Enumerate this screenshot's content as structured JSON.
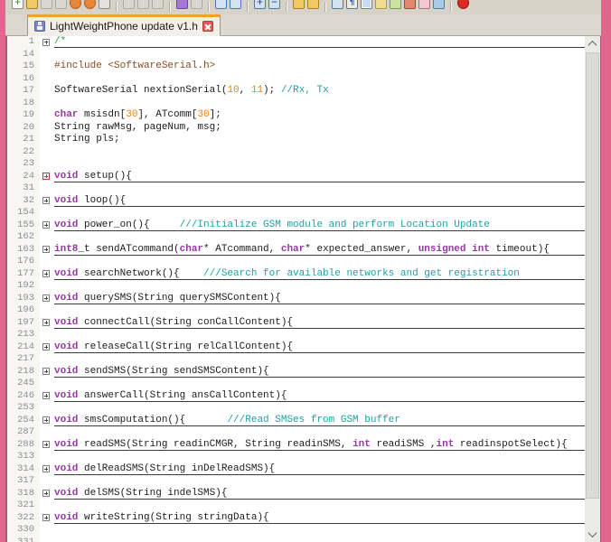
{
  "tab": {
    "title": "LightWeightPhone update v1.h"
  },
  "colors": {
    "window_border": "#E0668D",
    "window_border_inner": "#A85878",
    "toolbar_bg": "#D7D3C8",
    "tabbar_bg": "#DCD8CF",
    "tab_active_bg": "#F2EFE9",
    "tab_active_top": "#EFA22E",
    "tab_border": "#9A968E",
    "tab_close_bg": "#DF5A56",
    "floppy_icon": "#7F86C4",
    "editor_bg": "#FFFFFF",
    "gutter_bg": "#F7F6F3",
    "line_number": "#8D8D96",
    "fold_line": "#3A3A3A",
    "fold_box_border": "#7E7E7E",
    "fold_box_red": "#C23432",
    "keyword": "#9638A4",
    "number": "#EF8300",
    "comment": "#1BA2A6",
    "preprocessor": "#8A4A22",
    "block_comment": "#2E9E3E",
    "code_text": "#1C1C1C",
    "scroll_track": "#ECECE7",
    "scroll_thumb": "#DCDCD6",
    "scroll_arrow": "#5A5A5A"
  },
  "toolbar": {
    "groups": [
      [
        {
          "name": "new-file-button",
          "bg": "#FFFFFF",
          "border": "#8A8A82",
          "glyph": "+",
          "fg": "#3AA53A"
        },
        {
          "name": "open-file-button",
          "bg": "#F0C965",
          "border": "#AA8025"
        },
        {
          "name": "save-button",
          "bg": "#D9D7D0",
          "border": "#ABABA3",
          "state": "disabled"
        },
        {
          "name": "save-all-button",
          "bg": "#D9D7D0",
          "border": "#ABABA3",
          "state": "disabled"
        },
        {
          "name": "close-button",
          "bg": "#E8863C",
          "border": "#B55A14",
          "shape": "round"
        },
        {
          "name": "close-all-button",
          "bg": "#E8863C",
          "border": "#B55A14",
          "shape": "round"
        },
        {
          "name": "print-button",
          "bg": "#E3E2DC",
          "border": "#8A8A82"
        }
      ],
      [
        {
          "name": "cut-button",
          "bg": "#D9D7D0",
          "border": "#ABABA3",
          "state": "disabled"
        },
        {
          "name": "copy-button",
          "bg": "#D9D7D0",
          "border": "#ABABA3",
          "state": "disabled"
        },
        {
          "name": "paste-button",
          "bg": "#D9D7D0",
          "border": "#ABABA3",
          "state": "disabled"
        }
      ],
      [
        {
          "name": "undo-button",
          "bg": "#A477D8",
          "border": "#6E3FAE"
        },
        {
          "name": "redo-button",
          "bg": "#D9D7D0",
          "border": "#ABABA3",
          "state": "disabled"
        }
      ],
      [
        {
          "name": "find-button",
          "bg": "#D5E2F2",
          "border": "#4A7AB6"
        },
        {
          "name": "replace-button",
          "bg": "#D5E2F2",
          "border": "#4A7AB6"
        }
      ],
      [
        {
          "name": "zoom-in-button",
          "bg": "#D5E2F2",
          "border": "#4A7AB6",
          "glyph": "+",
          "fg": "#2B5FA8"
        },
        {
          "name": "zoom-out-button",
          "bg": "#D5E2F2",
          "border": "#4A7AB6",
          "glyph": "−",
          "fg": "#2B5FA8"
        }
      ],
      [
        {
          "name": "sync-vertical-scrolling-button",
          "bg": "#F0C965",
          "border": "#AA8025"
        },
        {
          "name": "sync-horizontal-scrolling-button",
          "bg": "#F0C965",
          "border": "#AA8025"
        }
      ],
      [
        {
          "name": "word-wrap-button",
          "bg": "#D5E2F2",
          "border": "#4A7AB6"
        },
        {
          "name": "show-all-characters-button",
          "bg": "#EDEDE8",
          "border": "#4A7AB6",
          "glyph": "¶",
          "fg": "#2B5FA8"
        },
        {
          "name": "show-indent-guide-button",
          "bg": "#C9DCF2",
          "border": "#4E82C8",
          "state": "pressed"
        },
        {
          "name": "user-defined-language-button",
          "bg": "#EFDE8E",
          "border": "#A89A3E"
        },
        {
          "name": "document-map-button",
          "bg": "#CBE3A2",
          "border": "#6FA23E"
        },
        {
          "name": "function-list-button",
          "bg": "#E2876F",
          "border": "#A8442A"
        },
        {
          "name": "folder-as-workspace-button",
          "bg": "#F2C7D4",
          "border": "#BE6484"
        },
        {
          "name": "monitoring-button",
          "bg": "#A9C9E9",
          "border": "#4A7AB6"
        }
      ],
      [
        {
          "name": "start-recording-macro-button",
          "bg": "#DA2C20",
          "border": "#8E150E",
          "shape": "round"
        }
      ]
    ]
  },
  "editor": {
    "rows": [
      {
        "n": 1,
        "fold": "plus",
        "folded": true,
        "segs": [
          [
            "grn",
            "/*"
          ]
        ]
      },
      {
        "n": 14,
        "segs": []
      },
      {
        "n": 15,
        "segs": [
          [
            "pre",
            "#include <SoftwareSerial.h>"
          ]
        ]
      },
      {
        "n": 16,
        "segs": []
      },
      {
        "n": 17,
        "segs": [
          [
            "pl",
            "SoftwareSerial nextionSerial("
          ],
          [
            "num",
            "10"
          ],
          [
            "pl",
            ", "
          ],
          [
            "num",
            "11"
          ],
          [
            "pl",
            "); "
          ],
          [
            "cmt",
            "//Rx, Tx"
          ]
        ]
      },
      {
        "n": 18,
        "segs": []
      },
      {
        "n": 19,
        "segs": [
          [
            "kw",
            "char"
          ],
          [
            "pl",
            " msisdn["
          ],
          [
            "num",
            "30"
          ],
          [
            "pl",
            "], ATcomm["
          ],
          [
            "num",
            "30"
          ],
          [
            "pl",
            "];"
          ]
        ]
      },
      {
        "n": 20,
        "segs": [
          [
            "pl",
            "String rawMsg, pageNum, msg;"
          ]
        ]
      },
      {
        "n": 21,
        "segs": [
          [
            "pl",
            "String pls;"
          ]
        ]
      },
      {
        "n": 22,
        "segs": []
      },
      {
        "n": 23,
        "segs": []
      },
      {
        "n": 24,
        "fold": "plus-red",
        "folded": true,
        "segs": [
          [
            "kw",
            "void"
          ],
          [
            "pl",
            " setup(){"
          ]
        ]
      },
      {
        "n": 31,
        "segs": []
      },
      {
        "n": 32,
        "fold": "plus",
        "folded": true,
        "segs": [
          [
            "kw",
            "void"
          ],
          [
            "pl",
            " loop(){"
          ]
        ]
      },
      {
        "n": 154,
        "segs": []
      },
      {
        "n": 155,
        "fold": "plus",
        "folded": true,
        "segs": [
          [
            "kw",
            "void"
          ],
          [
            "pl",
            " power_on(){     "
          ],
          [
            "cmt",
            "///Initialize GSM module and perform Location Update"
          ]
        ]
      },
      {
        "n": 162,
        "segs": []
      },
      {
        "n": 163,
        "fold": "plus",
        "folded": true,
        "segs": [
          [
            "kw",
            "int8"
          ],
          [
            "pl",
            "_t sendATcommand("
          ],
          [
            "kw",
            "char"
          ],
          [
            "pl",
            "* ATcommand, "
          ],
          [
            "kw",
            "char"
          ],
          [
            "pl",
            "* expected_answer, "
          ],
          [
            "kw",
            "unsigned int"
          ],
          [
            "pl",
            " timeout){"
          ]
        ]
      },
      {
        "n": 176,
        "segs": []
      },
      {
        "n": 177,
        "fold": "plus",
        "folded": true,
        "segs": [
          [
            "kw",
            "void"
          ],
          [
            "pl",
            " searchNetwork(){    "
          ],
          [
            "cmt",
            "///Search for available networks and get registration"
          ]
        ]
      },
      {
        "n": 192,
        "segs": []
      },
      {
        "n": 193,
        "fold": "plus",
        "folded": true,
        "segs": [
          [
            "kw",
            "void"
          ],
          [
            "pl",
            " querySMS(String querySMSContent){"
          ]
        ]
      },
      {
        "n": 196,
        "segs": []
      },
      {
        "n": 197,
        "fold": "plus",
        "folded": true,
        "segs": [
          [
            "kw",
            "void"
          ],
          [
            "pl",
            " connectCall(String conCallContent){"
          ]
        ]
      },
      {
        "n": 213,
        "segs": []
      },
      {
        "n": 214,
        "fold": "plus",
        "folded": true,
        "segs": [
          [
            "kw",
            "void"
          ],
          [
            "pl",
            " releaseCall(String relCallContent){"
          ]
        ]
      },
      {
        "n": 217,
        "segs": []
      },
      {
        "n": 218,
        "fold": "plus",
        "folded": true,
        "segs": [
          [
            "kw",
            "void"
          ],
          [
            "pl",
            " sendSMS(String sendSMSContent){"
          ]
        ]
      },
      {
        "n": 245,
        "segs": []
      },
      {
        "n": 246,
        "fold": "plus",
        "folded": true,
        "segs": [
          [
            "kw",
            "void"
          ],
          [
            "pl",
            " answerCall(String ansCallContent){"
          ]
        ]
      },
      {
        "n": 253,
        "segs": []
      },
      {
        "n": 254,
        "fold": "plus",
        "folded": true,
        "segs": [
          [
            "kw",
            "void"
          ],
          [
            "pl",
            " smsComputation(){       "
          ],
          [
            "cmt",
            "///Read SMSes from GSM buffer"
          ]
        ]
      },
      {
        "n": 287,
        "segs": []
      },
      {
        "n": 288,
        "fold": "plus",
        "folded": true,
        "segs": [
          [
            "kw",
            "void"
          ],
          [
            "pl",
            " readSMS(String readinCMGR, String readinSMS, "
          ],
          [
            "kw",
            "int"
          ],
          [
            "pl",
            " readiSMS ,"
          ],
          [
            "kw",
            "int"
          ],
          [
            "pl",
            " readinspotSelect){"
          ]
        ]
      },
      {
        "n": 313,
        "segs": []
      },
      {
        "n": 314,
        "fold": "plus",
        "folded": true,
        "segs": [
          [
            "kw",
            "void"
          ],
          [
            "pl",
            " delReadSMS(String inDelReadSMS){"
          ]
        ]
      },
      {
        "n": 317,
        "segs": []
      },
      {
        "n": 318,
        "fold": "plus",
        "folded": true,
        "segs": [
          [
            "kw",
            "void"
          ],
          [
            "pl",
            " delSMS(String indelSMS){"
          ]
        ]
      },
      {
        "n": 321,
        "segs": []
      },
      {
        "n": 322,
        "fold": "plus",
        "folded": true,
        "segs": [
          [
            "kw",
            "void"
          ],
          [
            "pl",
            " writeString(String stringData){"
          ]
        ]
      },
      {
        "n": 330,
        "segs": []
      },
      {
        "n": 331,
        "segs": []
      }
    ]
  }
}
